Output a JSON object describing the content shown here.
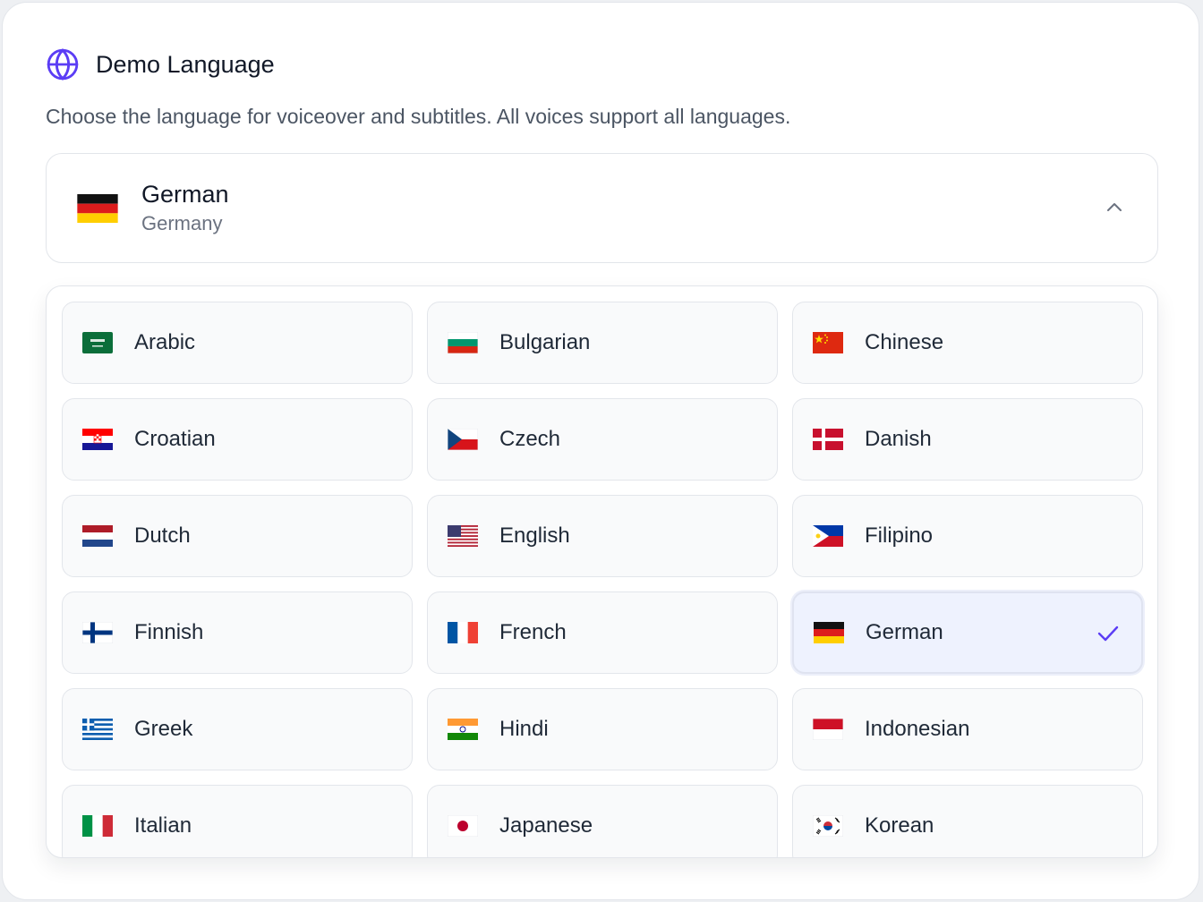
{
  "header": {
    "title": "Demo Language",
    "description": "Choose the language for voiceover and subtitles. All voices support all languages.",
    "icon": "globe-icon",
    "accent_color": "#5b3df5"
  },
  "selected": {
    "language": "German",
    "country": "Germany",
    "flag": "flag-de-icon"
  },
  "options": [
    {
      "label": "Arabic",
      "flag": "flag-sa-icon"
    },
    {
      "label": "Bulgarian",
      "flag": "flag-bg-icon"
    },
    {
      "label": "Chinese",
      "flag": "flag-cn-icon"
    },
    {
      "label": "Croatian",
      "flag": "flag-hr-icon"
    },
    {
      "label": "Czech",
      "flag": "flag-cz-icon"
    },
    {
      "label": "Danish",
      "flag": "flag-dk-icon"
    },
    {
      "label": "Dutch",
      "flag": "flag-nl-icon"
    },
    {
      "label": "English",
      "flag": "flag-us-icon"
    },
    {
      "label": "Filipino",
      "flag": "flag-ph-icon"
    },
    {
      "label": "Finnish",
      "flag": "flag-fi-icon"
    },
    {
      "label": "French",
      "flag": "flag-fr-icon"
    },
    {
      "label": "German",
      "flag": "flag-de-icon"
    },
    {
      "label": "Greek",
      "flag": "flag-gr-icon"
    },
    {
      "label": "Hindi",
      "flag": "flag-in-icon"
    },
    {
      "label": "Indonesian",
      "flag": "flag-id-icon"
    },
    {
      "label": "Italian",
      "flag": "flag-it-icon"
    },
    {
      "label": "Japanese",
      "flag": "flag-jp-icon"
    },
    {
      "label": "Korean",
      "flag": "flag-kr-icon"
    }
  ]
}
